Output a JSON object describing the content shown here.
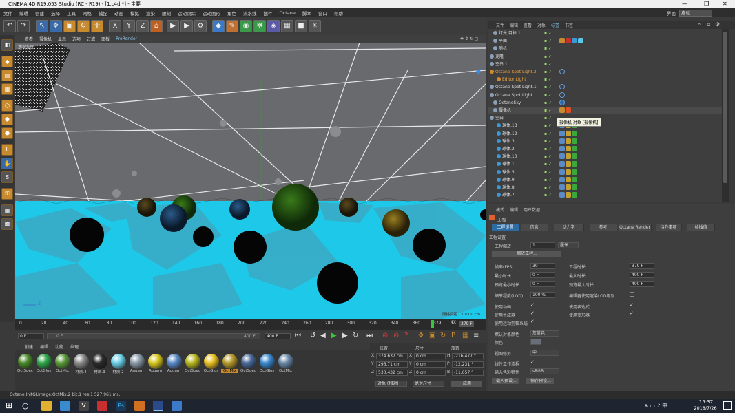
{
  "window": {
    "title": "CINEMA 4D R19.053 Studio (RC - R19) - [1.c4d *] - 主要"
  },
  "menubar": {
    "items": [
      "文件",
      "编辑",
      "创建",
      "选择",
      "工具",
      "网格",
      "捕捉",
      "动画",
      "模拟",
      "渲染",
      "雕刻",
      "运动跟踪",
      "运动图形",
      "角色",
      "流水线",
      "插件",
      "Octane",
      "脚本",
      "窗口",
      "帮助"
    ],
    "layout_label": "界面",
    "layout_value": "启动"
  },
  "viewport": {
    "menu": [
      "查看",
      "摄像机",
      "显示",
      "选项",
      "过滤",
      "面板",
      "ProRender"
    ],
    "label": "透视视图",
    "grid_info": "网格间距 : 10000 cm",
    "axis_label": "Z"
  },
  "timeline": {
    "ticks": [
      "0",
      "20",
      "40",
      "60",
      "80",
      "100",
      "120",
      "140",
      "160",
      "180",
      "200",
      "220",
      "240",
      "260",
      "280",
      "300",
      "320",
      "340",
      "360",
      "379"
    ],
    "end_label": "4X",
    "current_frame": "379 F",
    "start_field": "0 F",
    "min_field": "0 F",
    "range_field": "400 F",
    "max_field": "400 F",
    "slider_end": "400 F"
  },
  "materials": {
    "menu": [
      "创建",
      "编辑",
      "功能",
      "纹理"
    ],
    "items": [
      {
        "label": "OctSpec",
        "color": "#4a8a2a"
      },
      {
        "label": "OctGlos",
        "color": "#2fa84a"
      },
      {
        "label": "OctMix",
        "color": "#5a9a3a"
      },
      {
        "label": "材质.4",
        "color": "#8a8a8a"
      },
      {
        "label": "材质.3",
        "color": "#2a2a2a"
      },
      {
        "label": "材质.2",
        "color": "#6ad0e8"
      },
      {
        "label": "Aquam",
        "color": "#8a9aa8"
      },
      {
        "label": "Aquam",
        "color": "#d8c820"
      },
      {
        "label": "Aquam",
        "color": "#5a8ac8"
      },
      {
        "label": "OctSpec",
        "color": "#b8b820"
      },
      {
        "label": "OctGlos",
        "color": "#e8c020"
      },
      {
        "label": "OctMix",
        "color": "#b89a2a"
      },
      {
        "label": "OctSpec",
        "color": "#4a6a9a"
      },
      {
        "label": "OctGlos",
        "color": "#3a8ad0"
      },
      {
        "label": "OctMix",
        "color": "#6a8aa8"
      }
    ]
  },
  "coords": {
    "headers": [
      "位置",
      "尺寸",
      "旋转"
    ],
    "rows": [
      {
        "axis": "X",
        "pos": "374.637 cm",
        "size_axis": "X",
        "size": "0 cm",
        "rot_axis": "H",
        "rot": "-216.477 °"
      },
      {
        "axis": "Y",
        "pos": "296.71 cm",
        "size_axis": "Y",
        "size": "0 cm",
        "rot_axis": "P",
        "rot": "-12.231 °"
      },
      {
        "axis": "Z",
        "pos": "530.432 cm",
        "size_axis": "Z",
        "size": "0 cm",
        "rot_axis": "B",
        "rot": "-11.657 °"
      }
    ],
    "mode_select": "对象 (相对)",
    "size_select": "绝对尺寸",
    "apply_button": "应用"
  },
  "object_manager": {
    "menu": [
      "文件",
      "编辑",
      "查看",
      "对象",
      "标签",
      "书签"
    ],
    "tooltip": "摄像机 对象 [摄像机]",
    "rows": [
      {
        "name": "灯光 目标.1",
        "indent": 1,
        "selected": false,
        "highlight": false
      },
      {
        "name": "平面",
        "indent": 1,
        "selected": false,
        "highlight": false
      },
      {
        "name": "随机",
        "indent": 1,
        "selected": false,
        "highlight": false
      },
      {
        "name": "克隆",
        "indent": 0,
        "selected": false,
        "highlight": false
      },
      {
        "name": "空白.1",
        "indent": 0,
        "selected": false,
        "highlight": false
      },
      {
        "name": "Octane Spot Light.2",
        "indent": 0,
        "selected": false,
        "highlight": true
      },
      {
        "name": "Editor Light",
        "indent": 2,
        "selected": false,
        "highlight": true
      },
      {
        "name": "Octane Spot Light.1",
        "indent": 0,
        "selected": false,
        "highlight": false
      },
      {
        "name": "Octane Spot Light",
        "indent": 0,
        "selected": false,
        "highlight": false
      },
      {
        "name": "OctaneSky",
        "indent": 1,
        "selected": false,
        "highlight": false
      },
      {
        "name": "摄像机",
        "indent": 1,
        "selected": true,
        "highlight": false
      },
      {
        "name": "空白",
        "indent": 0,
        "selected": false,
        "highlight": false
      },
      {
        "name": "球体.13",
        "indent": 2,
        "selected": false,
        "highlight": false
      },
      {
        "name": "球体.12",
        "indent": 2,
        "selected": false,
        "highlight": false
      },
      {
        "name": "球体.3",
        "indent": 2,
        "selected": false,
        "highlight": false
      },
      {
        "name": "球体.2",
        "indent": 2,
        "selected": false,
        "highlight": false
      },
      {
        "name": "球体.10",
        "indent": 2,
        "selected": false,
        "highlight": false
      },
      {
        "name": "球体.1",
        "indent": 2,
        "selected": false,
        "highlight": false
      },
      {
        "name": "球体.5",
        "indent": 2,
        "selected": false,
        "highlight": false
      },
      {
        "name": "球体.9",
        "indent": 2,
        "selected": false,
        "highlight": false
      },
      {
        "name": "球体.8",
        "indent": 2,
        "selected": false,
        "highlight": false
      },
      {
        "name": "球体.7",
        "indent": 2,
        "selected": false,
        "highlight": false
      }
    ]
  },
  "attributes": {
    "menu": [
      "模式",
      "编辑",
      "用户数据"
    ],
    "title": "工程",
    "tabs": [
      "工程设置",
      "信息",
      "动力学",
      "参考",
      "Octane Render",
      "待办事项",
      "帧插值"
    ],
    "section": "工程设置",
    "scale_label": "工程缩放",
    "scale_value": "1",
    "scale_unit": "厘米",
    "scale_button": "缩放工程...",
    "fps_label": "帧率(FPS)",
    "fps_value": "30",
    "min_time_label": "最小时长",
    "min_time_value": "0 F",
    "preview_min_label": "预览最小时长",
    "preview_min_value": "0 F",
    "duration_label": "工程时长",
    "duration_value": "379 F",
    "max_time_label": "最大时长",
    "max_time_value": "400 F",
    "preview_max_label": "预览最大时长",
    "preview_max_value": "400 F",
    "lod_label": "细节程度(LOD)",
    "lod_value": "100 %",
    "lod_render_label": "编辑器使用渲染LOD级别",
    "use_anim_label": "使用动画",
    "use_gen_label": "使用生成器",
    "use_motion_label": "使用运动剪辑系统",
    "use_expr_label": "使用表达式",
    "use_deform_label": "使用变形器",
    "default_color_label": "默认对象颜色",
    "default_color_value": "灰蓝色",
    "color_label": "颜色",
    "view_clip_label": "视图修剪",
    "view_clip_value": "中",
    "linear_label": "线性工作流程",
    "input_color_label": "输入色彩特性",
    "input_color_value": "sRGB",
    "load_preset": "载入预设...",
    "save_preset": "保存预设..."
  },
  "status": {
    "text": "Octane:InitGLImage:OctMix.2  bit:1 res:1  527.961 ms."
  },
  "taskbar": {
    "time": "15:37",
    "date": "2018/7/26"
  }
}
